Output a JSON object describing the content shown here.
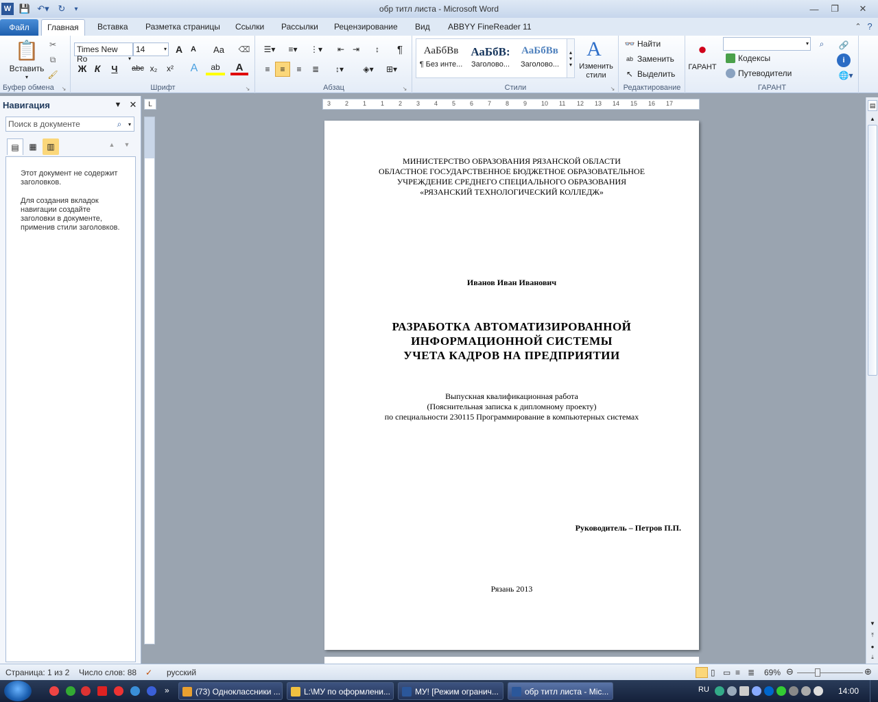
{
  "window": {
    "title": "обр титл листа  -  Microsoft Word"
  },
  "tabs": [
    "Файл",
    "Главная",
    "Вставка",
    "Разметка страницы",
    "Ссылки",
    "Рассылки",
    "Рецензирование",
    "Вид",
    "ABBYY FineReader 11"
  ],
  "ribbon": {
    "clipboard": {
      "paste": "Вставить",
      "label": "Буфер обмена"
    },
    "font": {
      "name": "Times New Ro",
      "size": "14",
      "bold": "Ж",
      "italic": "К",
      "underline": "Ч",
      "strike": "abc",
      "sub": "x₂",
      "sup": "x²",
      "case": "Aa",
      "grow": "A",
      "shrink": "A",
      "label": "Шрифт"
    },
    "paragraph": {
      "label": "Абзац",
      "pilcrow": "¶"
    },
    "styles": {
      "items": [
        {
          "sample": "АаБбВв",
          "name": "¶ Без инте..."
        },
        {
          "sample": "АаБбВ:",
          "name": "Заголово..."
        },
        {
          "sample": "АаБбВв",
          "name": "Заголово..."
        }
      ],
      "change": "Изменить стили",
      "label": "Стили"
    },
    "editing": {
      "find": "Найти",
      "replace": "Заменить",
      "select": "Выделить",
      "label": "Редактирование"
    },
    "garant": {
      "title": "ГАРАНТ",
      "codex": "Кодексы",
      "guides": "Путеводители",
      "label": "ГАРАНТ"
    }
  },
  "navigation": {
    "title": "Навигация",
    "search_placeholder": "Поиск в документе",
    "text1": "Этот документ не содержит заголовков.",
    "text2": "Для создания вкладок навигации создайте заголовки в документе, применив стили заголовков."
  },
  "document": {
    "header1": "МИНИСТЕРСТВО ОБРАЗОВАНИЯ РЯЗАНСКОЙ ОБЛАСТИ",
    "header2": "ОБЛАСТНОЕ ГОСУДАРСТВЕННОЕ БЮДЖЕТНОЕ ОБРАЗОВАТЕЛЬНОЕ",
    "header3": "УЧРЕЖДЕНИЕ СРЕДНЕГО СПЕЦИАЛЬНОГО ОБРАЗОВАНИЯ",
    "header4": "«РЯЗАНСКИЙ ТЕХНОЛОГИЧЕСКИЙ КОЛЛЕДЖ»",
    "author": "Иванов Иван Иванович",
    "title1": "РАЗРАБОТКА АВТОМАТИЗИРОВАННОЙ",
    "title2": "ИНФОРМАЦИОННОЙ  СИСТЕМЫ",
    "title3": "УЧЕТА КАДРОВ НА ПРЕДПРИЯТИИ",
    "sub1": "Выпускная квалификационная работа",
    "sub2": "(Пояснительная записка к дипломному проекту)",
    "sub3": "по специальности 230115 Программирование в компьютерных системах",
    "supervisor": "Руководитель – Петров П.П.",
    "city": "Рязань 2013"
  },
  "status": {
    "page": "Страница: 1 из 2",
    "words": "Число слов: 88",
    "lang": "русский",
    "zoom": "69%"
  },
  "taskbar": {
    "tasks": [
      "(73) Одноклассники ...",
      "L:\\МУ по оформлени...",
      "МУ! [Режим огранич...",
      "обр титл листа - Mic..."
    ],
    "tray_lang": "RU",
    "clock": "14:00"
  },
  "ruler_numbers": [
    "3",
    "2",
    "1",
    "1",
    "2",
    "3",
    "4",
    "5",
    "6",
    "7",
    "8",
    "9",
    "10",
    "11",
    "12",
    "13",
    "14",
    "15",
    "16",
    "17"
  ]
}
